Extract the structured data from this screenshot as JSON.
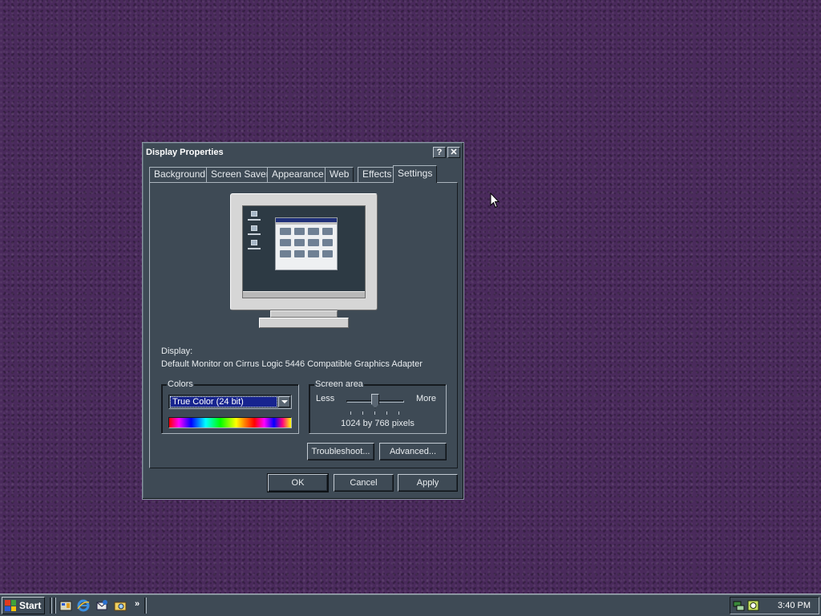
{
  "dialog": {
    "title": "Display Properties",
    "help_label": "?",
    "close_label": "✕",
    "tabs": [
      {
        "label": "Background"
      },
      {
        "label": "Screen Saver"
      },
      {
        "label": "Appearance"
      },
      {
        "label": "Web"
      },
      {
        "label": "Effects"
      },
      {
        "label": "Settings"
      }
    ],
    "active_tab": "Settings",
    "display_label": "Display:",
    "display_value": "Default Monitor on Cirrus Logic 5446 Compatible Graphics Adapter",
    "colors": {
      "group_label": "Colors",
      "selected": "True Color (24 bit)"
    },
    "screen_area": {
      "group_label": "Screen area",
      "less_label": "Less",
      "more_label": "More",
      "resolution": "1024 by 768 pixels",
      "slider_position": 0.5
    },
    "buttons": {
      "troubleshoot": "Troubleshoot...",
      "advanced": "Advanced...",
      "ok": "OK",
      "cancel": "Cancel",
      "apply": "Apply"
    }
  },
  "taskbar": {
    "start_label": "Start",
    "quick_launch": [
      {
        "icon": "show-desktop-icon"
      },
      {
        "icon": "internet-explorer-icon"
      },
      {
        "icon": "outlook-express-icon"
      },
      {
        "icon": "windows-explorer-icon"
      }
    ],
    "more_label": "»",
    "tray_icons": [
      {
        "icon": "network-icon"
      },
      {
        "icon": "scheduler-icon"
      }
    ],
    "clock": "3:40 PM"
  },
  "colors": {
    "desktop": "#4a2a5c",
    "window_face": "#3e4a55",
    "selection": "#17248f"
  }
}
